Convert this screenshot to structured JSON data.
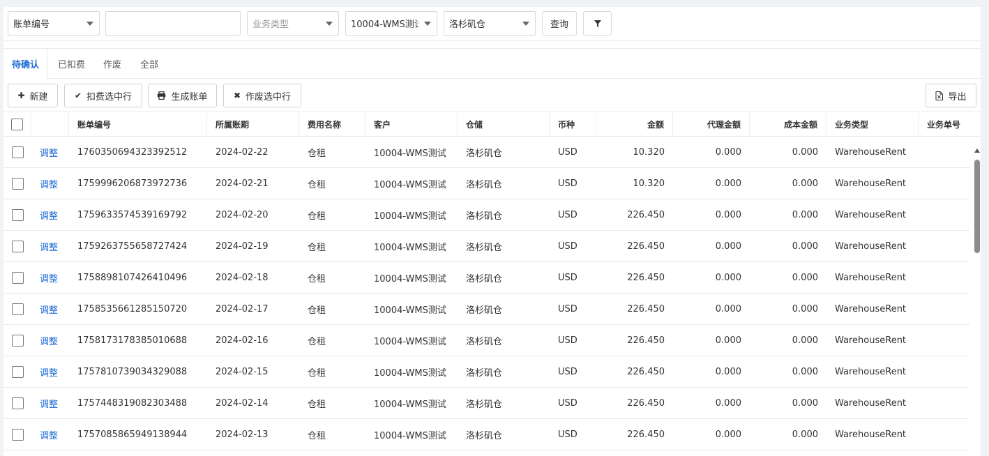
{
  "filters": {
    "field_select": "账单编号",
    "search_value": "",
    "business_type_placeholder": "业务类型",
    "customer_select": "10004-WMS测试",
    "warehouse_select": "洛杉矶仓",
    "query_label": "查询",
    "filter_icon": "filter-icon"
  },
  "tabs": [
    {
      "label": "待确认",
      "active": true
    },
    {
      "label": "已扣费",
      "active": false
    },
    {
      "label": "作废",
      "active": false
    },
    {
      "label": "全部",
      "active": false
    }
  ],
  "toolbar": {
    "new_label": "新建",
    "new_icon": "plus-icon",
    "deduct_label": "扣费选中行",
    "deduct_icon": "check-icon",
    "generate_label": "生成账单",
    "generate_icon": "printer-icon",
    "void_label": "作废选中行",
    "void_icon": "x-icon",
    "export_label": "导出",
    "export_icon": "export-file-icon"
  },
  "table": {
    "columns": [
      "账单编号",
      "所属账期",
      "费用名称",
      "客户",
      "仓储",
      "币种",
      "金额",
      "代理金额",
      "成本金额",
      "业务类型",
      "业务单号"
    ],
    "action_label": "调整",
    "rows": [
      {
        "bill_no": "1760350694323392512",
        "period": "2024-02-22",
        "fee": "仓租",
        "customer": "10004-WMS测试",
        "warehouse": "洛杉矶仓",
        "currency": "USD",
        "amount": "10.320",
        "agent_amount": "0.000",
        "cost_amount": "0.000",
        "biz_type": "WarehouseRent",
        "biz_no": ""
      },
      {
        "bill_no": "1759996206873972736",
        "period": "2024-02-21",
        "fee": "仓租",
        "customer": "10004-WMS测试",
        "warehouse": "洛杉矶仓",
        "currency": "USD",
        "amount": "10.320",
        "agent_amount": "0.000",
        "cost_amount": "0.000",
        "biz_type": "WarehouseRent",
        "biz_no": ""
      },
      {
        "bill_no": "1759633574539169792",
        "period": "2024-02-20",
        "fee": "仓租",
        "customer": "10004-WMS测试",
        "warehouse": "洛杉矶仓",
        "currency": "USD",
        "amount": "226.450",
        "agent_amount": "0.000",
        "cost_amount": "0.000",
        "biz_type": "WarehouseRent",
        "biz_no": ""
      },
      {
        "bill_no": "1759263755658727424",
        "period": "2024-02-19",
        "fee": "仓租",
        "customer": "10004-WMS测试",
        "warehouse": "洛杉矶仓",
        "currency": "USD",
        "amount": "226.450",
        "agent_amount": "0.000",
        "cost_amount": "0.000",
        "biz_type": "WarehouseRent",
        "biz_no": ""
      },
      {
        "bill_no": "1758898107426410496",
        "period": "2024-02-18",
        "fee": "仓租",
        "customer": "10004-WMS测试",
        "warehouse": "洛杉矶仓",
        "currency": "USD",
        "amount": "226.450",
        "agent_amount": "0.000",
        "cost_amount": "0.000",
        "biz_type": "WarehouseRent",
        "biz_no": ""
      },
      {
        "bill_no": "1758535661285150720",
        "period": "2024-02-17",
        "fee": "仓租",
        "customer": "10004-WMS测试",
        "warehouse": "洛杉矶仓",
        "currency": "USD",
        "amount": "226.450",
        "agent_amount": "0.000",
        "cost_amount": "0.000",
        "biz_type": "WarehouseRent",
        "biz_no": ""
      },
      {
        "bill_no": "1758173178385010688",
        "period": "2024-02-16",
        "fee": "仓租",
        "customer": "10004-WMS测试",
        "warehouse": "洛杉矶仓",
        "currency": "USD",
        "amount": "226.450",
        "agent_amount": "0.000",
        "cost_amount": "0.000",
        "biz_type": "WarehouseRent",
        "biz_no": ""
      },
      {
        "bill_no": "1757810739034329088",
        "period": "2024-02-15",
        "fee": "仓租",
        "customer": "10004-WMS测试",
        "warehouse": "洛杉矶仓",
        "currency": "USD",
        "amount": "226.450",
        "agent_amount": "0.000",
        "cost_amount": "0.000",
        "biz_type": "WarehouseRent",
        "biz_no": ""
      },
      {
        "bill_no": "1757448319082303488",
        "period": "2024-02-14",
        "fee": "仓租",
        "customer": "10004-WMS测试",
        "warehouse": "洛杉矶仓",
        "currency": "USD",
        "amount": "226.450",
        "agent_amount": "0.000",
        "cost_amount": "0.000",
        "biz_type": "WarehouseRent",
        "biz_no": ""
      },
      {
        "bill_no": "1757085865949138944",
        "period": "2024-02-13",
        "fee": "仓租",
        "customer": "10004-WMS测试",
        "warehouse": "洛杉矶仓",
        "currency": "USD",
        "amount": "226.450",
        "agent_amount": "0.000",
        "cost_amount": "0.000",
        "biz_type": "WarehouseRent",
        "biz_no": ""
      }
    ]
  },
  "colors": {
    "accent": "#1e6bd6",
    "page_bg": "#f0f2f5"
  }
}
